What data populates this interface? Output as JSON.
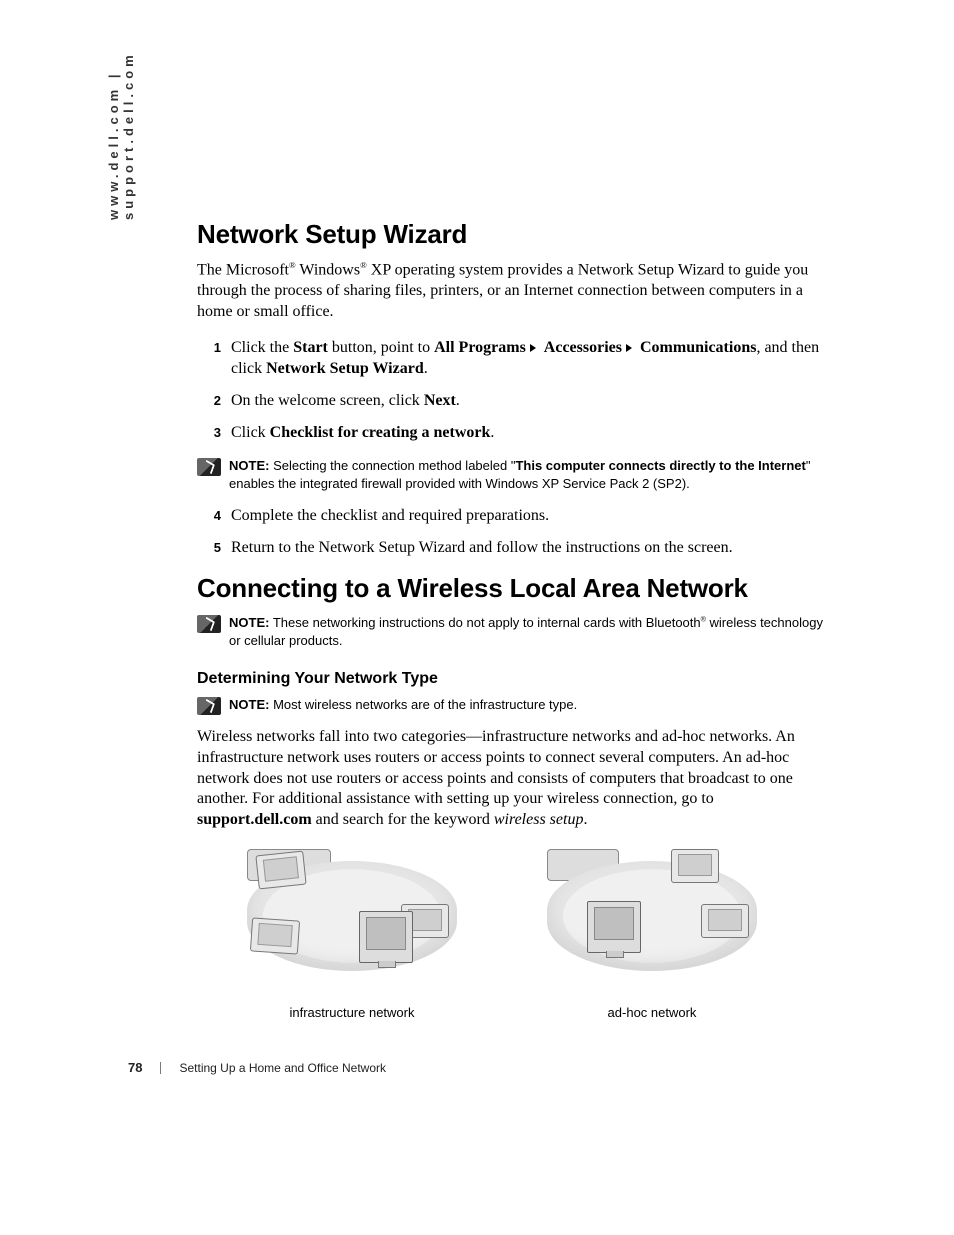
{
  "side_url": "www.dell.com | support.dell.com",
  "section1": {
    "heading": "Network Setup Wizard",
    "intro_pre": "The Microsoft",
    "intro_mid": " Windows",
    "intro_post": " XP operating system provides a Network Setup Wizard to guide you through the process of sharing files, printers, or an Internet connection between computers in a home or small office.",
    "steps": {
      "s1_pre": "Click the ",
      "s1_b1": "Start",
      "s1_mid1": " button, point to ",
      "s1_b2": "All Programs",
      "s1_b3": "Accessories",
      "s1_b4": "Communications",
      "s1_mid2": ", and then click ",
      "s1_b5": "Network Setup Wizard",
      "s1_end": ".",
      "s2_pre": "On the welcome screen, click ",
      "s2_b1": "Next",
      "s2_end": ".",
      "s3_pre": "Click ",
      "s3_b1": "Checklist for creating a network",
      "s3_end": ".",
      "s4": "Complete the checklist and required preparations.",
      "s5": "Return to the Network Setup Wizard and follow the instructions on the screen."
    },
    "note": {
      "label": "NOTE:",
      "pre": " Selecting the connection method labeled \"",
      "bold": "This computer connects directly to the Internet",
      "post": "\" enables the integrated firewall provided with Windows XP Service Pack 2 (SP2)."
    }
  },
  "section2": {
    "heading": "Connecting to a Wireless Local Area Network",
    "note1": {
      "label": "NOTE:",
      "pre": " These networking instructions do not apply to internal cards with Bluetooth",
      "post": " wireless technology or cellular products."
    },
    "sub": "Determining Your Network Type",
    "note2": {
      "label": "NOTE:",
      "text": " Most wireless networks are of the infrastructure type."
    },
    "para_pre": "Wireless networks fall into two categories—infrastructure networks and ad-hoc networks. An infrastructure network uses routers or access points to connect several computers. An ad-hoc network does not use routers or access points and consists of computers that broadcast to one another. For additional assistance with setting up your wireless connection, go to ",
    "para_bold": "support.dell.com",
    "para_mid": " and search for the keyword ",
    "para_ital": "wireless setup",
    "para_end": ".",
    "fig1_cap": "infrastructure network",
    "fig2_cap": "ad-hoc network"
  },
  "footer": {
    "page": "78",
    "title": "Setting Up a Home and Office Network"
  },
  "reg": "®"
}
